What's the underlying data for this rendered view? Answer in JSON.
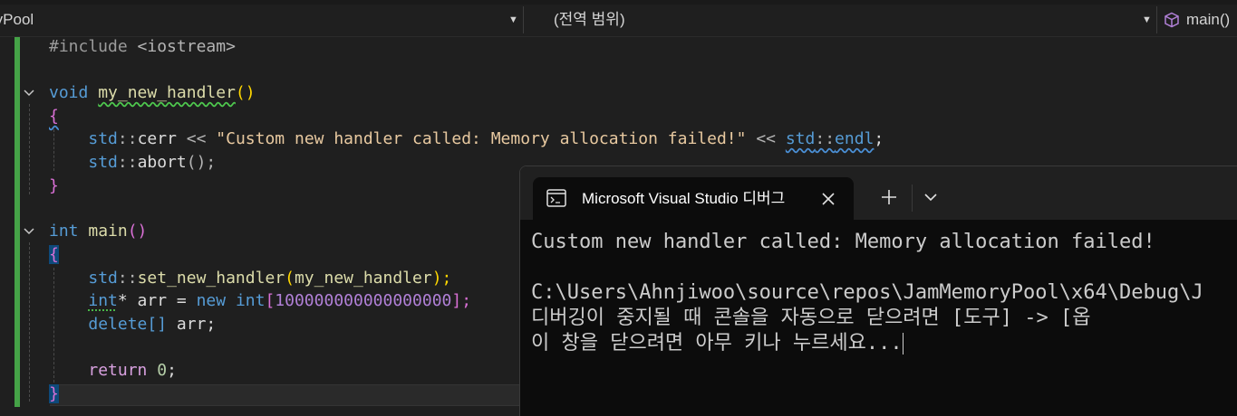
{
  "navbar": {
    "project_combo": "ryPool",
    "scope_combo": "(전역 범위)",
    "function_combo": "main()",
    "function_icon": "cube-icon"
  },
  "editor": {
    "line1": {
      "directive": "#include",
      "header": "<iostream>"
    },
    "line3": {
      "kw": "void",
      "name": "my_new_handler",
      "parens": "()"
    },
    "line4": {
      "brace": "{"
    },
    "line5": {
      "ns": "std",
      "sep": "::",
      "ident": "cerr",
      "op": " << ",
      "string": "\"Custom new handler called: Memory allocation failed!\"",
      "op2": " << ",
      "ns2": "std",
      "sep2": "::",
      "ident2": "endl",
      "semi": ";"
    },
    "line6": {
      "ns": "std",
      "sep": "::",
      "ident": "abort",
      "rest": "();"
    },
    "line7": {
      "brace": "}"
    },
    "line9": {
      "kw": "int",
      "name": "main",
      "parens": "()"
    },
    "line10": {
      "brace": "{"
    },
    "line11": {
      "ns": "std",
      "sep": "::",
      "ident": "set_new_handler",
      "open": "(",
      "arg": "my_new_handler",
      "close": ");"
    },
    "line12": {
      "kw": "int",
      "star": "*",
      "var": " arr = ",
      "kw_new": "new",
      "space": " ",
      "kw_int": "int",
      "open": "[",
      "number": "100000000000000000",
      "close": "];"
    },
    "line13": {
      "kw": "delete",
      "brackets": "[]",
      "var": " arr;"
    },
    "line15": {
      "kw": "return",
      "space": " ",
      "number": "0",
      "semi": ";"
    },
    "line16": {
      "brace": "}"
    }
  },
  "console": {
    "tab_title": "Microsoft Visual Studio 디버그",
    "tab_icon": "terminal-icon",
    "lines": [
      "Custom new handler called: Memory allocation failed!",
      "",
      "C:\\Users\\Ahnjiwoo\\source\\repos\\JamMemoryPool\\x64\\Debug\\J",
      "디버깅이 중지될 때 콘솔을 자동으로 닫으려면 [도구] -> [옵",
      "이 창을 닫으려면 아무 키나 누르세요..."
    ]
  }
}
